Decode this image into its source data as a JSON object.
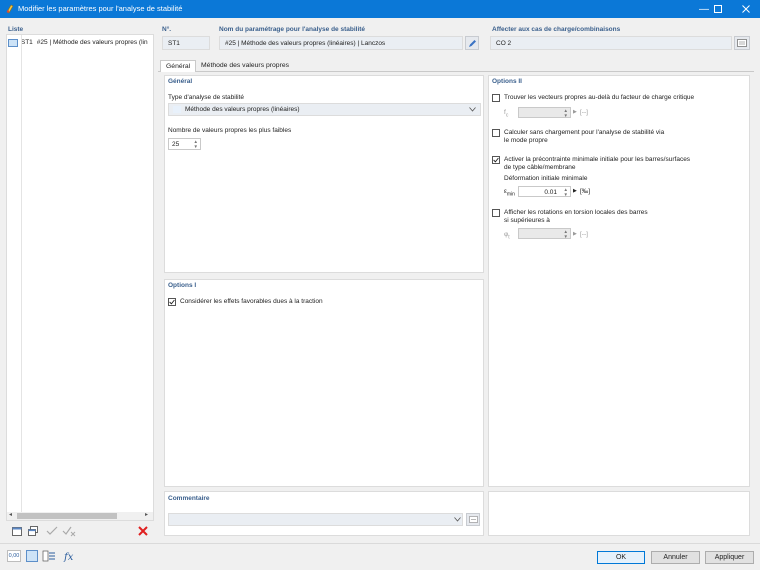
{
  "window": {
    "title": "Modifier les paramètres pour l'analyse de stabilité",
    "accent": "#0b78d7"
  },
  "list": {
    "header": "Liste",
    "items": [
      {
        "id": "ST1",
        "label": "#25 | Méthode des valeurs propres (lin"
      }
    ]
  },
  "number": {
    "header": "N°.",
    "value": "ST1"
  },
  "name": {
    "header": "Nom du paramétrage pour l'analyse de stabilité",
    "value": "#25 | Méthode des valeurs propres (linéaires) | Lanczos"
  },
  "assign": {
    "header": "Affecter aux cas de charge/combinaisons",
    "value": "CO 2"
  },
  "tabs": [
    {
      "label": "Général",
      "active": true
    },
    {
      "label": "Méthode des valeurs propres",
      "active": false
    }
  ],
  "general": {
    "title": "Général",
    "analysis_type_label": "Type d'analyse de stabilité",
    "analysis_type_value": "Méthode des valeurs propres (linéaires)",
    "eigen_count_label": "Nombre de valeurs propres les plus faibles",
    "eigen_count_value": "25"
  },
  "options1": {
    "title": "Options I",
    "favorable_label": "Considérer les effets favorables dues à la traction",
    "favorable_checked": true
  },
  "options2": {
    "title": "Options II",
    "find_vectors_label": "Trouver les vecteurs propres au-delà du facteur de charge critique",
    "find_vectors_checked": false,
    "f_symbol": "f",
    "f_sub": "c",
    "f_unit": "[--]",
    "no_load_label_1": "Calculer sans chargement pour l'analyse de stabilité via",
    "no_load_label_2": "le mode propre",
    "no_load_checked": false,
    "prestress_label_1": "Activer la précontrainte minimale initiale pour les barres/surfaces",
    "prestress_label_2": "de type câble/membrane",
    "prestress_checked": true,
    "min_def_label": "Déformation initiale minimale",
    "eps_symbol": "ε",
    "eps_sub": "min",
    "eps_value": "0.01",
    "eps_unit": "[‰]",
    "torsion_label_1": "Afficher les rotations en torsion locales des barres",
    "torsion_label_2": "si supérieures à",
    "torsion_checked": false,
    "phi_symbol": "φ",
    "phi_sub": "t",
    "phi_unit": "[--]"
  },
  "comment": {
    "title": "Commentaire",
    "value": ""
  },
  "buttons": {
    "ok": "OK",
    "cancel": "Annuler",
    "apply": "Appliquer"
  },
  "bottom_tools": {
    "units_label": "0,00"
  }
}
